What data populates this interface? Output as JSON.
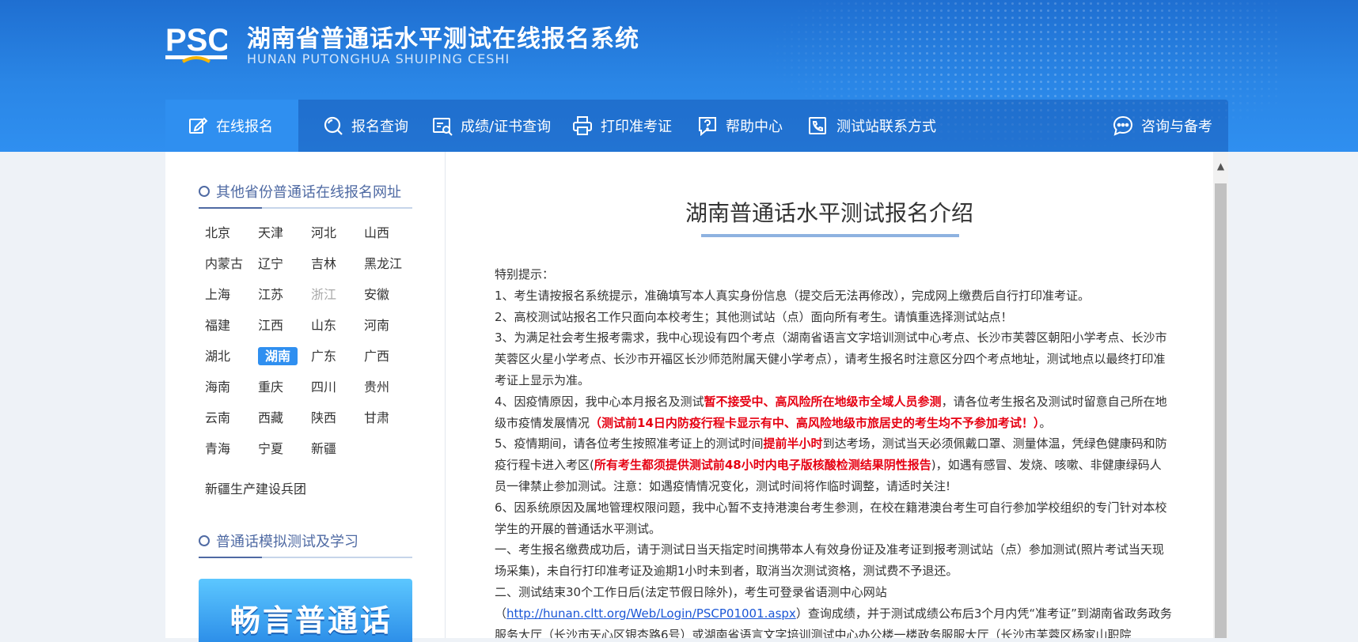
{
  "site": {
    "title": "湖南省普通话水平测试在线报名系统",
    "subtitle": "HUNAN PUTONGHUA SHUIPING CESHI",
    "logo_text": "PSC"
  },
  "nav": [
    {
      "label": "在线报名",
      "icon": "edit-icon",
      "active": true
    },
    {
      "label": "报名查询",
      "icon": "search-icon"
    },
    {
      "label": "成绩/证书查询",
      "icon": "certificate-search-icon"
    },
    {
      "label": "打印准考证",
      "icon": "printer-icon"
    },
    {
      "label": "帮助中心",
      "icon": "help-icon"
    },
    {
      "label": "测试站联系方式",
      "icon": "phone-contact-icon"
    },
    {
      "label": "咨询与备考",
      "icon": "chat-icon"
    }
  ],
  "sidebar": {
    "provinces_heading": "其他省份普通话在线报名网址",
    "provinces": [
      {
        "name": "北京"
      },
      {
        "name": "天津"
      },
      {
        "name": "河北"
      },
      {
        "name": "山西"
      },
      {
        "name": "内蒙古"
      },
      {
        "name": "辽宁"
      },
      {
        "name": "吉林"
      },
      {
        "name": "黑龙江"
      },
      {
        "name": "上海"
      },
      {
        "name": "江苏"
      },
      {
        "name": "浙江",
        "disabled": true
      },
      {
        "name": "安徽"
      },
      {
        "name": "福建"
      },
      {
        "name": "江西"
      },
      {
        "name": "山东"
      },
      {
        "name": "河南"
      },
      {
        "name": "湖北"
      },
      {
        "name": "湖南",
        "active": true
      },
      {
        "name": "广东"
      },
      {
        "name": "广西"
      },
      {
        "name": "海南"
      },
      {
        "name": "重庆"
      },
      {
        "name": "四川"
      },
      {
        "name": "贵州"
      },
      {
        "name": "云南"
      },
      {
        "name": "西藏"
      },
      {
        "name": "陕西"
      },
      {
        "name": "甘肃"
      },
      {
        "name": "青海"
      },
      {
        "name": "宁夏"
      },
      {
        "name": "新疆"
      }
    ],
    "extra_province": "新疆生产建设兵团",
    "practice_heading": "普通话模拟测试及学习",
    "banner_text": "畅言普通话"
  },
  "article": {
    "title": "湖南普通话水平测试报名介绍",
    "intro": "特别提示：",
    "p1": "1、考生请按报名系统提示，准确填写本人真实身份信息（提交后无法再修改），完成网上缴费后自行打印准考证。",
    "p2": "2、高校测试站报名工作只面向本校考生；其他测试站（点）面向所有考生。请慎重选择测试站点！",
    "p3": "3、为满足社会考生报考需求，我中心现设有四个考点（湖南省语言文字培训测试中心考点、长沙市芙蓉区朝阳小学考点、长沙市芙蓉区火星小学考点、长沙市开福区长沙师范附属天健小学考点），请考生报名时注意区分四个考点地址，测试地点以最终打印准考证上显示为准。",
    "p4_a": "4、因疫情原因，我中心本月报名及测试",
    "p4_red1": "暂不接受中、高风险所在地级市全域人员参测",
    "p4_b": "，请各位考生报名及测试时留意自己所在地级市疫情发展情况",
    "p4_red2": "（测试前14日内防疫行程卡显示有中、高风险地级市旅居史的考生均不予参加考试！）",
    "p4_c": "。",
    "p5_a": "5、疫情期间，请各位考生按照准考证上的测试时间",
    "p5_red1": "提前半小时",
    "p5_b": "到达考场，测试当天必须佩戴口罩、测量体温，凭绿色健康码和防疫行程卡进入考区(",
    "p5_red2": "所有考生都须提供测试前48小时内电子版核酸检测结果阴性报告",
    "p5_c": ")，如遇有感冒、发烧、咳嗽、非健康绿码人员一律禁止参加测试。注意：如遇疫情情况变化，测试时间将作临时调整，请适时关注!",
    "p6": "6、因系统原因及属地管理权限问题，我中心暂不支持港澳台考生参测，在校在籍港澳台考生可自行参加学校组织的专门针对本校学生的开展的普通话水平测试。",
    "s1": "一、考生报名缴费成功后，请于测试日当天指定时间携带本人有效身份证及准考证到报考测试站（点）参加测试(照片考试当天现场采集)，未自行打印准考证及逾期1小时未到者，取消当次测试资格，测试费不予退还。",
    "s2_a": "二、测试结束30个工作日后(法定节假日除外)，考生可登录省语测中心网站（",
    "s2_link": "http://hunan.cltt.org/Web/Login/PSCP01001.aspx",
    "s2_b": "）查询成绩，并于测试成绩公布后3个月内凭“准考证”到湖南省政务政务服务大厅（长沙市天心区银杏路6号）或湖南省语言文字培训测试中心办公楼一楼政务服服大厅（长沙市芙蓉区杨家山职院"
  },
  "colors": {
    "header_blue": "#2a86e6",
    "nav_active": "#2f8ff0",
    "accent_heading": "#4f6aa3",
    "warning_red": "#e60012",
    "link_blue": "#1a56d6"
  }
}
